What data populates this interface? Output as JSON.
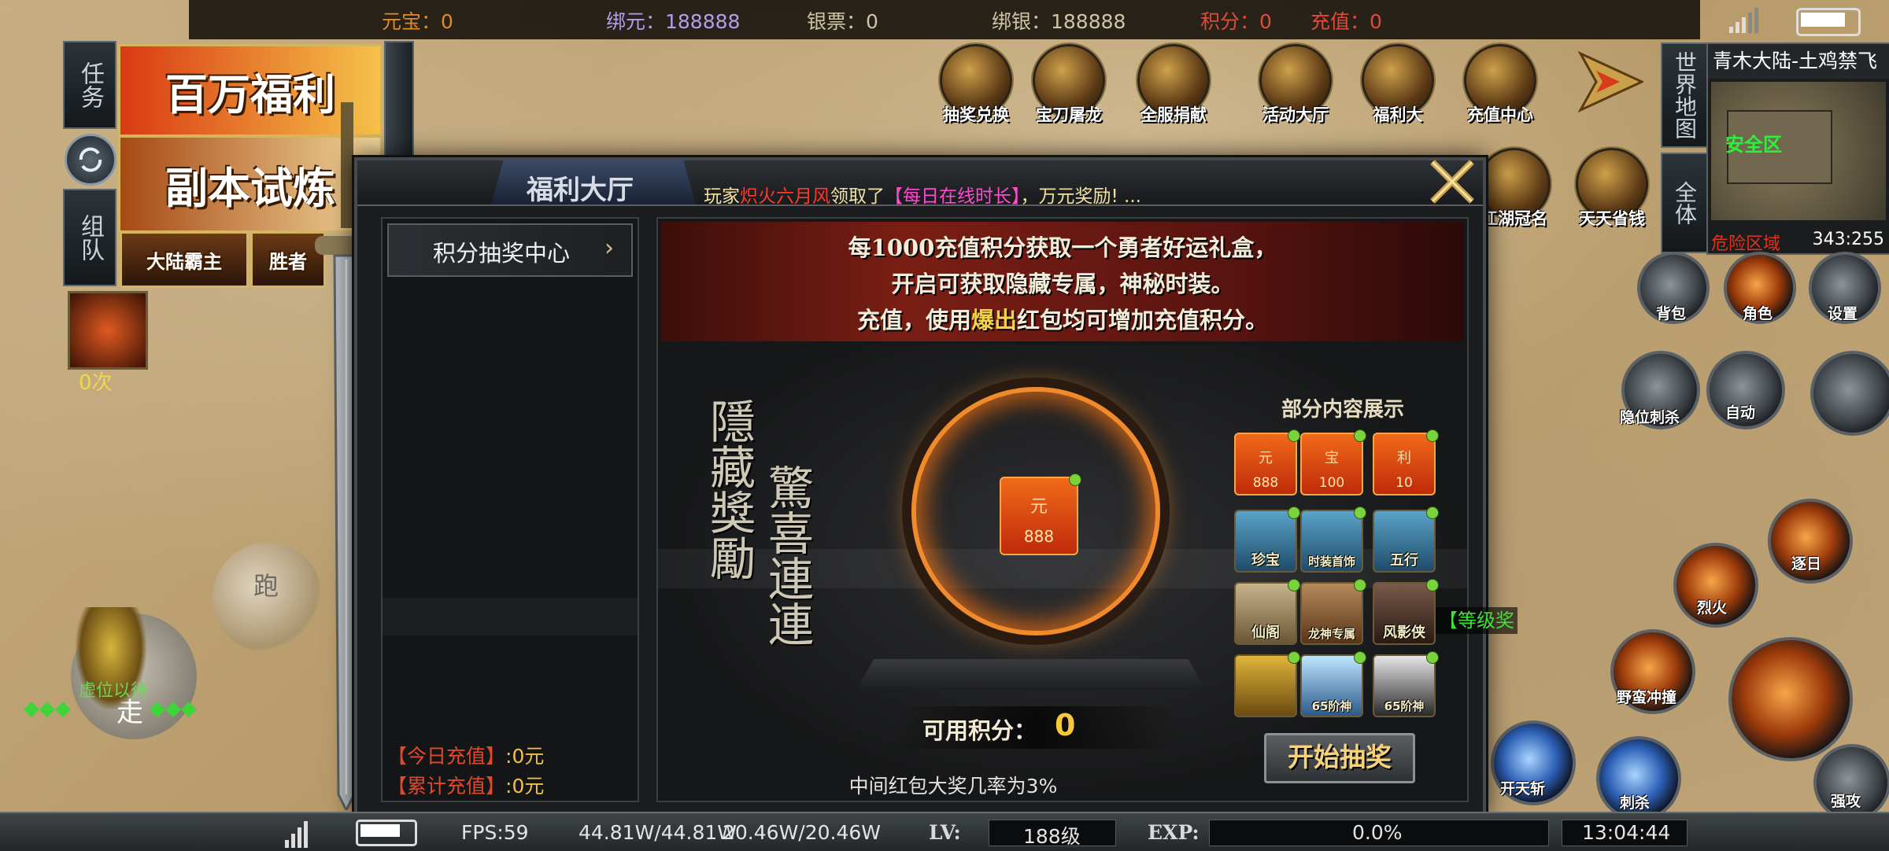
{
  "top_bar": {
    "yuanbao": "元宝：0",
    "bind_yuan": "绑元：188888",
    "yinpiao": "银票：0",
    "bind_silver": "绑银：188888",
    "points": "积分：0",
    "recharge": "充值：0"
  },
  "colors": {
    "orange": "#e08a2a",
    "purple": "#b19cf0",
    "red": "#e24a3a",
    "beige": "#cfc5a6",
    "gold": "#f0c04a"
  },
  "left_side": {
    "task_tab": "任务",
    "team_tab": "组队",
    "banner_million": "百万福利",
    "banner_dungeon": "副本试炼",
    "banner_small_1": "大陆霸主",
    "banner_small_2": "胜者",
    "buff_count": "0次"
  },
  "top_icons": [
    {
      "label": "抽奖兑换",
      "icon": "lottery-exchange-icon"
    },
    {
      "label": "宝刀屠龙",
      "icon": "dragon-blade-icon"
    },
    {
      "label": "全服捐献",
      "icon": "donation-icon"
    },
    {
      "label": "活动大厅",
      "icon": "event-hall-icon"
    },
    {
      "label": "福利大",
      "icon": "welfare-hall-icon"
    },
    {
      "label": "充值中心",
      "icon": "recharge-center-icon"
    }
  ],
  "second_row_icons": [
    {
      "label": "江湖冠名",
      "icon": "jianghu-title-icon"
    },
    {
      "label": "天天省钱",
      "icon": "save-money-icon"
    }
  ],
  "map_panel": {
    "world_map_tab": "世界地图",
    "full_tab": "全体",
    "location": "青木大陆-土鸡禁飞",
    "safe_zone": "安全区",
    "danger_zone": "危险区域",
    "coords": "343:255"
  },
  "right_menu": {
    "bag": "背包",
    "role": "角色",
    "settings": "设置"
  },
  "skills": [
    {
      "label": "隐位刺杀"
    },
    {
      "label": "自动"
    },
    {
      "label": "逐日"
    },
    {
      "label": "烈火"
    },
    {
      "label": "野蛮冲撞"
    },
    {
      "label": "开天斩"
    },
    {
      "label": "刺杀"
    },
    {
      "label": "强攻"
    }
  ],
  "player": {
    "run_label": "跑",
    "walk_label": "走",
    "player_name": "虚位以待",
    "diamonds": "◆◆◆",
    "diamonds_right": "◆◆◆"
  },
  "window": {
    "title": "福利大厅",
    "marquee_prefix": "玩家",
    "marquee_player": "炽火六月风",
    "marquee_mid": "领取了",
    "marquee_item": "【每日在线时长】",
    "marquee_suffix": "，万元奖励!  ...",
    "left_menu_item": "积分抽奖中心",
    "today_recharge_label": "【今日充值】",
    "today_recharge_value": ":0元",
    "total_recharge_label": "【累计充值】",
    "total_recharge_value": ":0元",
    "banner_line1": "每1000充值积分获取一个勇者好运礼盒，",
    "banner_line2": "开启可获取隐藏专属，神秘时装。",
    "banner_line3_a": "充值，使用",
    "banner_line3_b": "爆出",
    "banner_line3_c": "红包均可增加充值积分。",
    "calligraphy_left": "隱藏獎勵",
    "calligraphy_right": "驚喜連連",
    "center_item_num": "888",
    "center_item_char": "元",
    "preview_title": "部分内容展示",
    "preview_items": [
      {
        "name": "888",
        "char": "元",
        "type": "red"
      },
      {
        "name": "100",
        "char": "宝",
        "type": "red"
      },
      {
        "name": "10",
        "char": "利",
        "type": "red"
      },
      {
        "name": "珍宝",
        "type": "chest"
      },
      {
        "name": "时装首饰",
        "type": "chest"
      },
      {
        "name": "五行",
        "type": "chest"
      },
      {
        "name": "仙阁",
        "type": "box"
      },
      {
        "name": "龙神专属",
        "type": "box"
      },
      {
        "name": "风影侠",
        "type": "box"
      },
      {
        "name": "",
        "type": "gold"
      },
      {
        "name": "65阶神",
        "type": "god"
      },
      {
        "name": "65阶神",
        "type": "god"
      }
    ],
    "level_reward_tag": "【等级奖",
    "points_label": "可用积分：",
    "points_value": "0",
    "start_button": "开始抽奖",
    "note": "中间红包大奖几率为3%"
  },
  "bottom_bar": {
    "fps": "FPS:59",
    "hp": "44.81W/44.81W",
    "mp": "20.46W/20.46W",
    "lv_label": "LV:",
    "level": "188级",
    "exp_label": "EXP:",
    "exp": "0.0%",
    "exp_progress": 0.0,
    "time": "13:04:44"
  }
}
